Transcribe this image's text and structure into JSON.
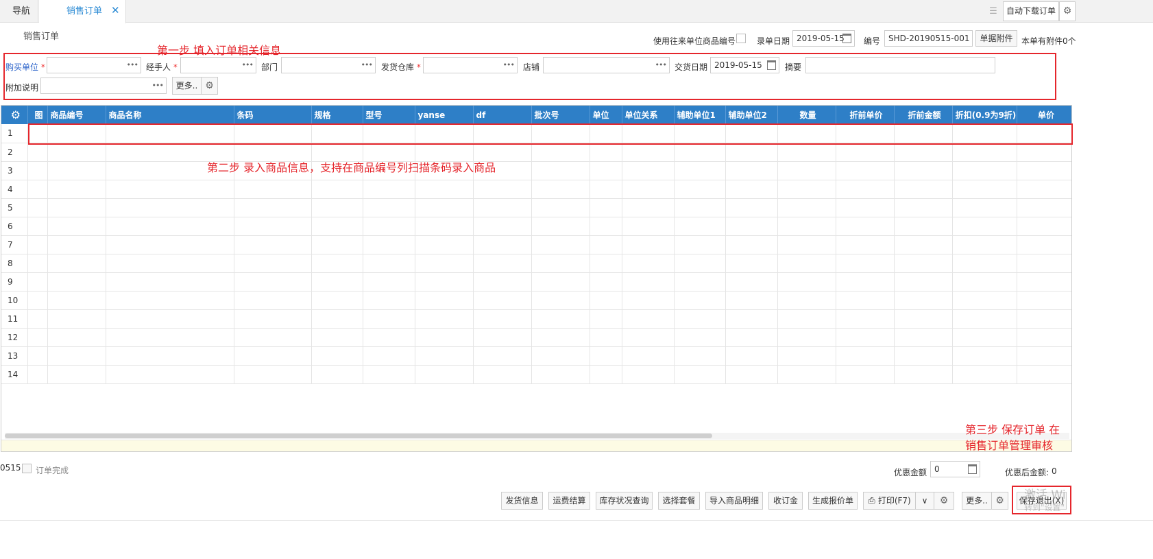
{
  "tabs": {
    "nav": "导航",
    "order": "销售订单"
  },
  "toolbar": {
    "auto_download": "自动下载订单"
  },
  "header": {
    "title": "销售订单",
    "use_partner_code_label": "使用往来单位商品编号",
    "entry_date_label": "录单日期",
    "entry_date_value": "2019-05-15",
    "number_label": "编号",
    "number_value": "SHD-20190515-001",
    "attachment_button": "单据附件",
    "attachment_count": "本单有附件0个"
  },
  "form": {
    "buyer_label": "购买单位",
    "handler_label": "经手人",
    "department_label": "部门",
    "warehouse_label": "发货仓库",
    "shop_label": "店铺",
    "delivery_date_label": "交货日期",
    "delivery_date_value": "2019-05-15",
    "summary_label": "摘要",
    "note_label": "附加说明",
    "more_button": "更多.."
  },
  "annotations": {
    "step1": "第一步   填入订单相关信息",
    "step2": "第二步  录入商品信息，支持在商品编号列扫描条码录入商品",
    "step3_line1": "第三步  保存订单  在",
    "step3_line2": "销售订单管理审核"
  },
  "grid": {
    "columns": [
      "图",
      "商品编号",
      "商品名称",
      "条码",
      "规格",
      "型号",
      "yanse",
      "df",
      "批次号",
      "单位",
      "单位关系",
      "辅助单位1",
      "辅助单位2",
      "数量",
      "折前单价",
      "折前金额",
      "折扣(0.9为9折)",
      "单价"
    ],
    "rows": [
      "1",
      "2",
      "3",
      "4",
      "5",
      "6",
      "7",
      "8",
      "9",
      "10",
      "11",
      "12",
      "13",
      "14"
    ]
  },
  "bottom": {
    "code_fragment": "0515",
    "order_complete_label": "订单完成",
    "discount_amount_label": "优惠金额",
    "discount_amount_value": "0",
    "after_discount_label": "优惠后金额:",
    "after_discount_value": "0"
  },
  "footer": {
    "buttons": [
      "发货信息",
      "运费结算",
      "库存状况查询",
      "选择套餐",
      "导入商品明细",
      "收订金",
      "生成报价单"
    ],
    "print": "打印(F7)",
    "more": "更多..",
    "save_exit": "保存退出(X)",
    "watermark_line1": "激活 Wi",
    "watermark_line2": "转到\"设置\""
  },
  "colors": {
    "header_blue": "#2e7fc7",
    "annotation_red": "#e5262c",
    "tab_blue": "#2a8ad4"
  }
}
